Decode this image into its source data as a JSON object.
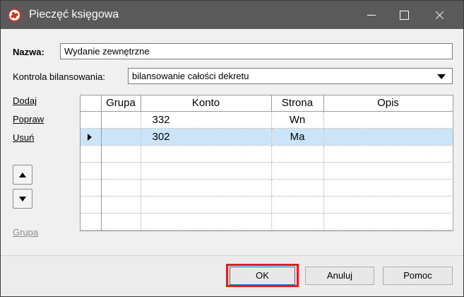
{
  "window": {
    "title": "Pieczęć księgowa"
  },
  "form": {
    "name_label": "Nazwa:",
    "name_value": "Wydanie zewnętrzne",
    "balance_label": "Kontrola bilansowania:",
    "balance_value": "bilansowanie całości dekretu"
  },
  "side_links": {
    "add": "Dodaj",
    "edit": "Popraw",
    "delete": "Usuń",
    "group": "Grupa"
  },
  "grid": {
    "columns": [
      "Grupa",
      "Konto",
      "Strona",
      "Opis"
    ],
    "rows": [
      {
        "grupa": "",
        "konto": "332",
        "strona": "Wn",
        "opis": ""
      },
      {
        "grupa": "",
        "konto": "302",
        "strona": "Ma",
        "opis": ""
      },
      {
        "grupa": "",
        "konto": "",
        "strona": "",
        "opis": ""
      },
      {
        "grupa": "",
        "konto": "",
        "strona": "",
        "opis": ""
      },
      {
        "grupa": "",
        "konto": "",
        "strona": "",
        "opis": ""
      },
      {
        "grupa": "",
        "konto": "",
        "strona": "",
        "opis": ""
      },
      {
        "grupa": "",
        "konto": "",
        "strona": "",
        "opis": ""
      }
    ]
  },
  "buttons": {
    "ok": "OK",
    "cancel": "Anuluj",
    "help": "Pomoc"
  },
  "colors": {
    "titlebar": "#5a5a5a",
    "selected_row": "#cce4f7",
    "highlight": "#e01c24"
  }
}
